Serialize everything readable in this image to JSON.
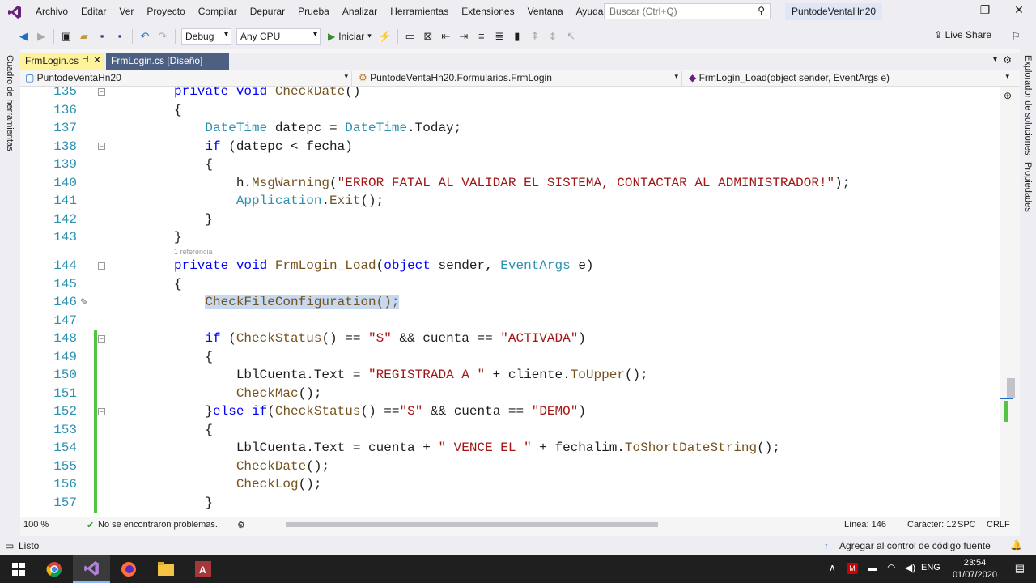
{
  "menu": [
    "Archivo",
    "Editar",
    "Ver",
    "Proyecto",
    "Compilar",
    "Depurar",
    "Prueba",
    "Analizar",
    "Herramientas",
    "Extensiones",
    "Ventana",
    "Ayuda"
  ],
  "search": {
    "placeholder": "Buscar (Ctrl+Q)"
  },
  "project_title": "PuntodeVentaHn20",
  "toolbar": {
    "config": "Debug",
    "platform": "Any CPU",
    "start": "Iniciar",
    "live_share": "Live Share"
  },
  "side": {
    "left": "Cuadro de herramientas",
    "right1": "Explorador de soluciones",
    "right2": "Propiedades"
  },
  "tabs": [
    {
      "label": "FrmLogin.cs",
      "pin": "⊣",
      "close": "✕"
    },
    {
      "label": "FrmLogin.cs [Diseño]"
    }
  ],
  "nav": {
    "project": "PuntodeVentaHn20",
    "class": "PuntodeVentaHn20.Formularios.FrmLogin",
    "member": "FrmLogin_Load(object sender, EventArgs e)"
  },
  "codelens": "1 referencia",
  "lines": [
    {
      "n": "135",
      "t": "private void CheckDate()"
    },
    {
      "n": "136",
      "t": "{"
    },
    {
      "n": "137",
      "t": "    DateTime datepc = DateTime.Today;"
    },
    {
      "n": "138",
      "t": "    if (datepc < fecha)"
    },
    {
      "n": "139",
      "t": "    {"
    },
    {
      "n": "140",
      "t": "        h.MsgWarning(\"ERROR FATAL AL VALIDAR EL SISTEMA, CONTACTAR AL ADMINISTRADOR!\");"
    },
    {
      "n": "141",
      "t": "        Application.Exit();"
    },
    {
      "n": "142",
      "t": "    }"
    },
    {
      "n": "143",
      "t": "}"
    },
    {
      "n": "144",
      "t": "private void FrmLogin_Load(object sender, EventArgs e)"
    },
    {
      "n": "145",
      "t": "{"
    },
    {
      "n": "146",
      "t": "    CheckFileConfiguration();"
    },
    {
      "n": "147",
      "t": ""
    },
    {
      "n": "148",
      "t": "    if (CheckStatus() == \"S\" && cuenta == \"ACTIVADA\")"
    },
    {
      "n": "149",
      "t": "    {"
    },
    {
      "n": "150",
      "t": "        LblCuenta.Text = \"REGISTRADA A \" + cliente.ToUpper();"
    },
    {
      "n": "151",
      "t": "        CheckMac();"
    },
    {
      "n": "152",
      "t": "    }else if(CheckStatus() ==\"S\" && cuenta == \"DEMO\")"
    },
    {
      "n": "153",
      "t": "    {"
    },
    {
      "n": "154",
      "t": "        LblCuenta.Text = cuenta + \" VENCE EL \" + fechalim.ToShortDateString();"
    },
    {
      "n": "155",
      "t": "        CheckDate();"
    },
    {
      "n": "156",
      "t": "        CheckLog();"
    },
    {
      "n": "157",
      "t": "    }"
    }
  ],
  "bottom": {
    "zoom": "100 %",
    "problems": "No se encontraron problemas.",
    "line": "Línea: 146",
    "char": "Carácter: 12",
    "spc": "SPC",
    "crlf": "CRLF"
  },
  "status": {
    "ready": "Listo",
    "source_control": "Agregar al control de código fuente"
  },
  "taskbar": {
    "lang": "ENG",
    "time": "23:54",
    "date": "01/07/2020"
  },
  "colors": {
    "accent": "#68217a",
    "tab_active": "#fff29d",
    "tab_inactive": "#4d6082",
    "keyword": "#0000ff",
    "type": "#2b91af",
    "string": "#a31515",
    "change": "#55c343"
  }
}
